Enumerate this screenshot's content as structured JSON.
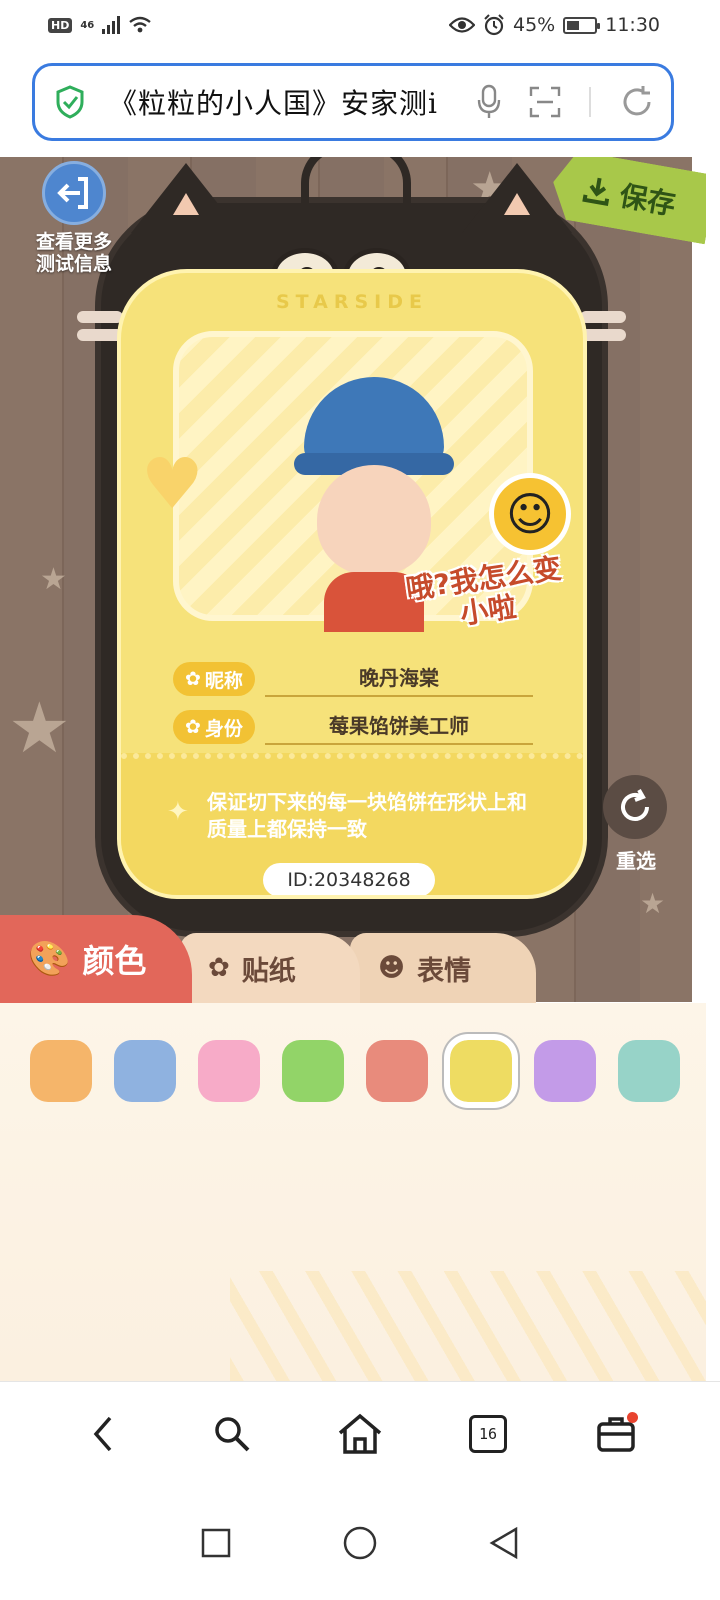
{
  "status_bar": {
    "hd": "HD",
    "network": "46",
    "battery": "45%",
    "battery_level": 0.45,
    "time": "11:30",
    "icons": [
      "eye-icon",
      "alarm-icon",
      "wifi-icon",
      "signal-icon"
    ]
  },
  "url_bar": {
    "text": "《粒粒的小人国》安家测i",
    "icons": [
      "shield-check-icon",
      "microphone-icon",
      "scan-icon",
      "refresh-icon"
    ]
  },
  "game": {
    "more_info_label": "查看更多测试信息",
    "save_label": "保存",
    "brand": "STARSIDE",
    "speech_bubble": "哦?我怎么变小啦",
    "nickname_tag": "昵称",
    "nickname_value": "晚丹海棠",
    "identity_tag": "身份",
    "identity_value": "莓果馅饼美工师",
    "motto": "保证切下来的每一块馅饼在形状上和质量上都保持一致",
    "id_label": "ID:20348268",
    "reselect_label": "重选"
  },
  "tabs": [
    {
      "label": "颜色",
      "icon": "palette-icon",
      "active": true
    },
    {
      "label": "贴纸",
      "icon": "sticker-icon",
      "active": false
    },
    {
      "label": "表情",
      "icon": "face-icon",
      "active": false
    }
  ],
  "swatches": {
    "colors": [
      "#f5b56a",
      "#8fb2e0",
      "#f7abc8",
      "#92d468",
      "#e88b7c",
      "#eedc62",
      "#c39be8",
      "#97d3c8"
    ],
    "selected_index": 5
  },
  "browser_nav": {
    "tab_count": "16",
    "icons": [
      "back-icon",
      "search-icon",
      "home-icon",
      "tabs-icon",
      "toolbox-icon"
    ]
  },
  "system_nav": {
    "icons": [
      "recents-icon",
      "home-circle-icon",
      "back-triangle-icon"
    ]
  }
}
